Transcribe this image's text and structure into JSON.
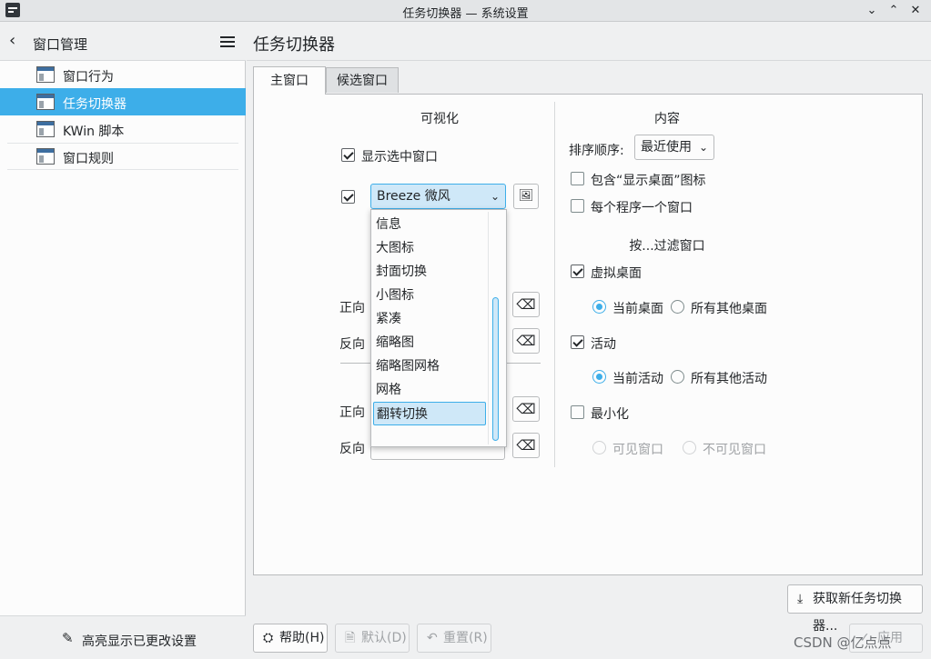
{
  "window": {
    "title": "任务切换器 — 系统设置"
  },
  "sidebar": {
    "title": "窗口管理",
    "items": [
      {
        "label": "窗口行为"
      },
      {
        "label": "任务切换器"
      },
      {
        "label": "KWin 脚本"
      },
      {
        "label": "窗口规则"
      }
    ],
    "footer_label": "高亮显示已更改设置"
  },
  "main": {
    "title": "任务切换器",
    "tabs": [
      {
        "label": "主窗口"
      },
      {
        "label": "候选窗口"
      }
    ]
  },
  "visual": {
    "title": "可视化",
    "show_selected": "显示选中窗口",
    "theme_value": "Breeze 微风",
    "forward_label": "正向",
    "reverse_label": "反向",
    "forward2_label": "正向",
    "reverse2_label": "反向"
  },
  "dropdown": {
    "options": [
      "信息",
      "大图标",
      "封面切换",
      "小图标",
      "紧凑",
      "缩略图",
      "缩略图网格",
      "网格",
      "翻转切换"
    ]
  },
  "content": {
    "title": "内容",
    "sort_label": "排序顺序:",
    "sort_value": "最近使用",
    "include_desktop": "包含“显示桌面”图标",
    "one_per_app": "每个程序一个窗口"
  },
  "filter": {
    "title": "按...过滤窗口",
    "virtual_desktop": "虚拟桌面",
    "current_desktop": "当前桌面",
    "other_desktops": "所有其他桌面",
    "activity": "活动",
    "current_activity": "当前活动",
    "other_activities": "所有其他活动",
    "minimized": "最小化",
    "visible_windows": "可见窗口",
    "invisible_windows": "不可见窗口"
  },
  "buttons": {
    "get_new": "获取新任务切换器...",
    "help": "帮助(H)",
    "defaults": "默认(D)",
    "reset": "重置(R)",
    "apply": "应用"
  },
  "watermark": "CSDN @亿点点"
}
